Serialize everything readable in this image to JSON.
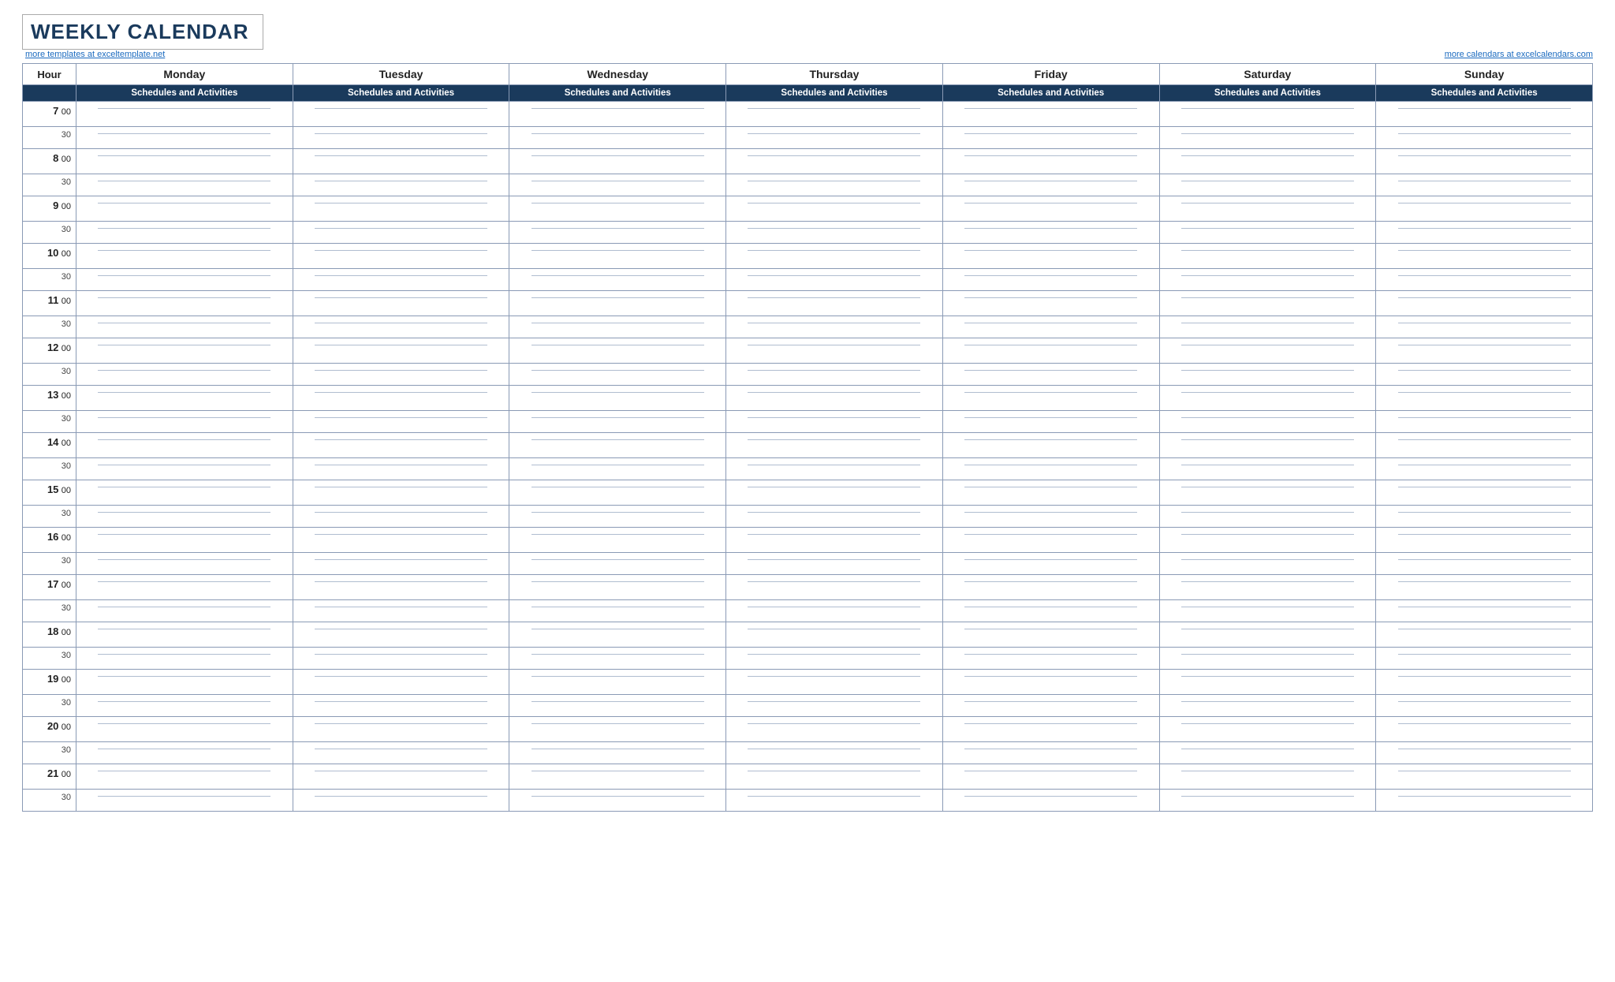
{
  "title": "WEEKLY CALENDAR",
  "link_left": "more templates at exceltemplate.net",
  "link_right": "more calendars at excelcalendars.com",
  "header": {
    "hour_label": "Hour",
    "days": [
      "Monday",
      "Tuesday",
      "Wednesday",
      "Thursday",
      "Friday",
      "Saturday",
      "Sunday"
    ],
    "schedules_label": "Schedules and Activities"
  },
  "hours": [
    {
      "hour": "7",
      "min": "00"
    },
    {
      "hour": "",
      "min": "30"
    },
    {
      "hour": "8",
      "min": "00"
    },
    {
      "hour": "",
      "min": "30"
    },
    {
      "hour": "9",
      "min": "00"
    },
    {
      "hour": "",
      "min": "30"
    },
    {
      "hour": "10",
      "min": "00"
    },
    {
      "hour": "",
      "min": "30"
    },
    {
      "hour": "11",
      "min": "00"
    },
    {
      "hour": "",
      "min": "30"
    },
    {
      "hour": "12",
      "min": "00"
    },
    {
      "hour": "",
      "min": "30"
    },
    {
      "hour": "13",
      "min": "00"
    },
    {
      "hour": "",
      "min": "30"
    },
    {
      "hour": "14",
      "min": "00"
    },
    {
      "hour": "",
      "min": "30"
    },
    {
      "hour": "15",
      "min": "00"
    },
    {
      "hour": "",
      "min": "30"
    },
    {
      "hour": "16",
      "min": "00"
    },
    {
      "hour": "",
      "min": "30"
    },
    {
      "hour": "17",
      "min": "00"
    },
    {
      "hour": "",
      "min": "30"
    },
    {
      "hour": "18",
      "min": "00"
    },
    {
      "hour": "",
      "min": "30"
    },
    {
      "hour": "19",
      "min": "00"
    },
    {
      "hour": "",
      "min": "30"
    },
    {
      "hour": "20",
      "min": "00"
    },
    {
      "hour": "",
      "min": "30"
    },
    {
      "hour": "21",
      "min": "00"
    },
    {
      "hour": "",
      "min": "30"
    }
  ]
}
